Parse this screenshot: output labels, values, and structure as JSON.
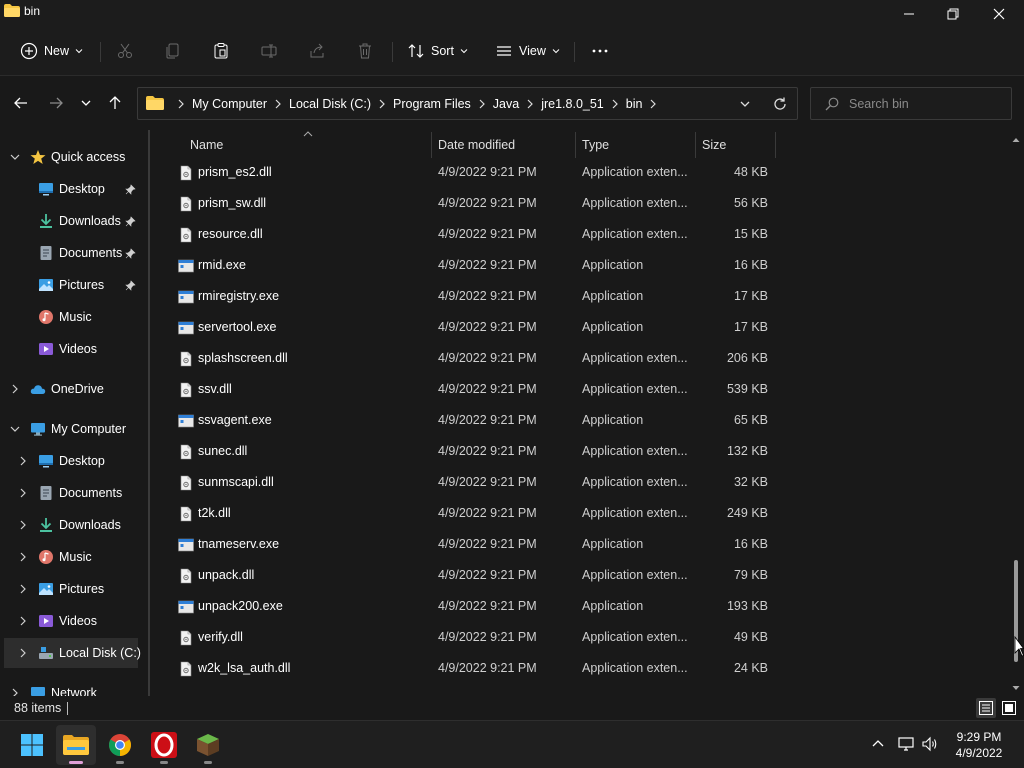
{
  "window": {
    "title": "bin",
    "controls": [
      "minimize",
      "restore",
      "close"
    ]
  },
  "commandbar": {
    "new_label": "New",
    "sort_label": "Sort",
    "view_label": "View",
    "icons": [
      "cut-icon",
      "copy-icon",
      "paste-icon",
      "rename-icon",
      "share-icon",
      "delete-icon",
      "more-icon"
    ]
  },
  "address": {
    "breadcrumbs": [
      "My Computer",
      "Local Disk (C:)",
      "Program Files",
      "Java",
      "jre1.8.0_51",
      "bin"
    ]
  },
  "search": {
    "placeholder": "Search bin"
  },
  "sidebar": {
    "items": [
      {
        "label": "Quick access",
        "icon": "star-icon"
      },
      {
        "label": "Desktop",
        "icon": "desktop-icon",
        "pinned": true
      },
      {
        "label": "Downloads",
        "icon": "download-icon",
        "pinned": true
      },
      {
        "label": "Documents",
        "icon": "documents-icon",
        "pinned": true
      },
      {
        "label": "Pictures",
        "icon": "pictures-icon",
        "pinned": true
      },
      {
        "label": "Music",
        "icon": "music-icon"
      },
      {
        "label": "Videos",
        "icon": "videos-icon"
      },
      {
        "label": "OneDrive",
        "icon": "cloud-icon"
      },
      {
        "label": "My Computer",
        "icon": "computer-icon"
      },
      {
        "label": "Desktop",
        "icon": "desktop-icon"
      },
      {
        "label": "Documents",
        "icon": "documents-icon"
      },
      {
        "label": "Downloads",
        "icon": "download-icon"
      },
      {
        "label": "Music",
        "icon": "music-icon"
      },
      {
        "label": "Pictures",
        "icon": "pictures-icon"
      },
      {
        "label": "Videos",
        "icon": "videos-icon"
      },
      {
        "label": "Local Disk (C:)",
        "icon": "drive-icon",
        "selected": true
      },
      {
        "label": "Network",
        "icon": "network-icon"
      }
    ]
  },
  "columns": {
    "name": "Name",
    "date": "Date modified",
    "type": "Type",
    "size": "Size"
  },
  "files": [
    {
      "name": "prism_es2.dll",
      "date": "4/9/2022 9:21 PM",
      "type": "Application exten...",
      "size": "48 KB",
      "kind": "dll"
    },
    {
      "name": "prism_sw.dll",
      "date": "4/9/2022 9:21 PM",
      "type": "Application exten...",
      "size": "56 KB",
      "kind": "dll"
    },
    {
      "name": "resource.dll",
      "date": "4/9/2022 9:21 PM",
      "type": "Application exten...",
      "size": "15 KB",
      "kind": "dll"
    },
    {
      "name": "rmid.exe",
      "date": "4/9/2022 9:21 PM",
      "type": "Application",
      "size": "16 KB",
      "kind": "exe"
    },
    {
      "name": "rmiregistry.exe",
      "date": "4/9/2022 9:21 PM",
      "type": "Application",
      "size": "17 KB",
      "kind": "exe"
    },
    {
      "name": "servertool.exe",
      "date": "4/9/2022 9:21 PM",
      "type": "Application",
      "size": "17 KB",
      "kind": "exe"
    },
    {
      "name": "splashscreen.dll",
      "date": "4/9/2022 9:21 PM",
      "type": "Application exten...",
      "size": "206 KB",
      "kind": "dll"
    },
    {
      "name": "ssv.dll",
      "date": "4/9/2022 9:21 PM",
      "type": "Application exten...",
      "size": "539 KB",
      "kind": "dll"
    },
    {
      "name": "ssvagent.exe",
      "date": "4/9/2022 9:21 PM",
      "type": "Application",
      "size": "65 KB",
      "kind": "exe"
    },
    {
      "name": "sunec.dll",
      "date": "4/9/2022 9:21 PM",
      "type": "Application exten...",
      "size": "132 KB",
      "kind": "dll"
    },
    {
      "name": "sunmscapi.dll",
      "date": "4/9/2022 9:21 PM",
      "type": "Application exten...",
      "size": "32 KB",
      "kind": "dll"
    },
    {
      "name": "t2k.dll",
      "date": "4/9/2022 9:21 PM",
      "type": "Application exten...",
      "size": "249 KB",
      "kind": "dll"
    },
    {
      "name": "tnameserv.exe",
      "date": "4/9/2022 9:21 PM",
      "type": "Application",
      "size": "16 KB",
      "kind": "exe"
    },
    {
      "name": "unpack.dll",
      "date": "4/9/2022 9:21 PM",
      "type": "Application exten...",
      "size": "79 KB",
      "kind": "dll"
    },
    {
      "name": "unpack200.exe",
      "date": "4/9/2022 9:21 PM",
      "type": "Application",
      "size": "193 KB",
      "kind": "exe"
    },
    {
      "name": "verify.dll",
      "date": "4/9/2022 9:21 PM",
      "type": "Application exten...",
      "size": "49 KB",
      "kind": "dll"
    },
    {
      "name": "w2k_lsa_auth.dll",
      "date": "4/9/2022 9:21 PM",
      "type": "Application exten...",
      "size": "24 KB",
      "kind": "dll"
    }
  ],
  "status": {
    "item_count": "88 items"
  },
  "taskbar": {
    "apps": [
      "windows-start",
      "file-explorer",
      "chrome",
      "opera",
      "minecraft"
    ],
    "time": "9:29 PM",
    "date": "4/9/2022"
  },
  "colors": {
    "background": "#191919",
    "folder": "#f4c542",
    "accent": "#60cdff"
  }
}
